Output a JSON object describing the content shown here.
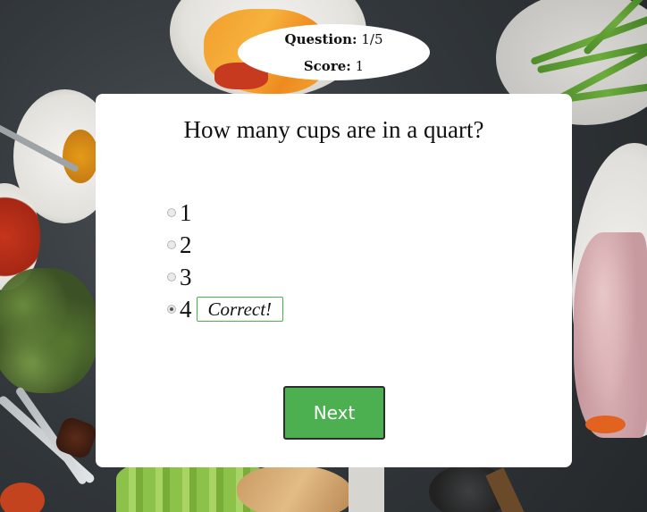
{
  "score_badge": {
    "question_label": "Question:",
    "question_value": "1/5",
    "score_label": "Score:",
    "score_value": "1"
  },
  "quiz": {
    "question": "How many cups are in a quart?",
    "options": [
      {
        "label": "1",
        "selected": false
      },
      {
        "label": "2",
        "selected": false
      },
      {
        "label": "3",
        "selected": false
      },
      {
        "label": "4",
        "selected": true
      }
    ],
    "feedback": "Correct!",
    "next_label": "Next"
  },
  "colors": {
    "accent": "#4caf50",
    "feedback_border": "#4caf50",
    "card_bg": "#ffffff"
  }
}
